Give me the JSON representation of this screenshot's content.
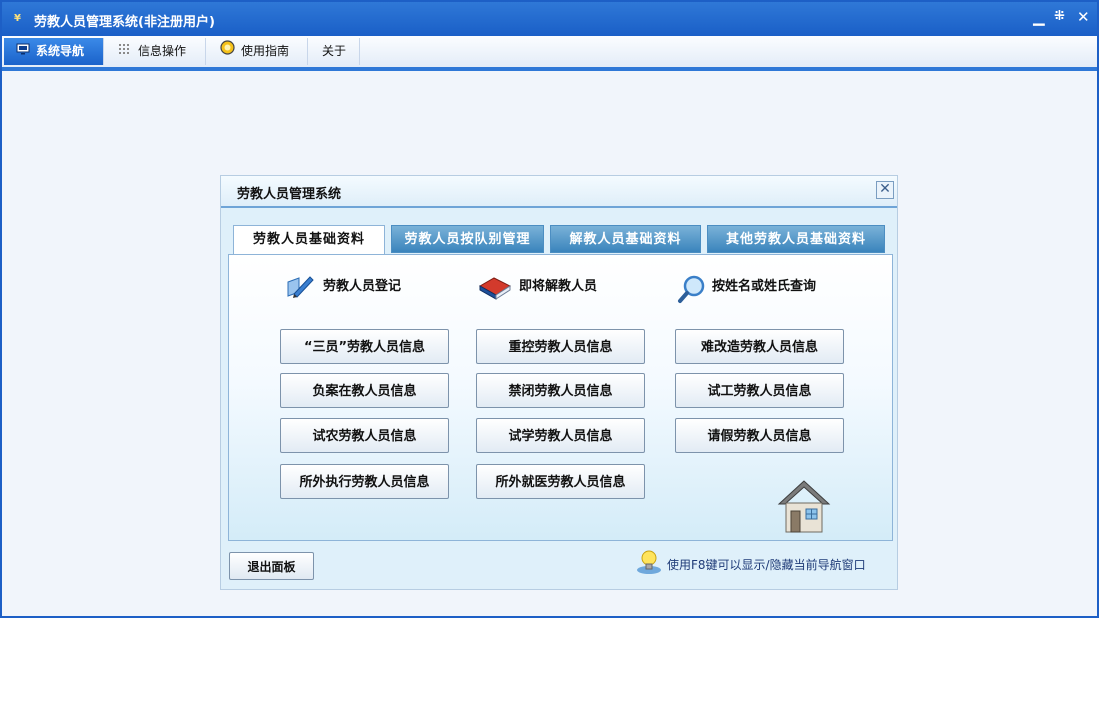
{
  "window": {
    "title": "劳教人员管理系统(非注册用户)",
    "app_icon": "¥"
  },
  "menu": {
    "tabs": [
      {
        "label": "系统导航",
        "icon": "monitor-icon"
      },
      {
        "label": "信息操作",
        "icon": "grid-icon"
      },
      {
        "label": "使用指南",
        "icon": "help-circle-icon"
      },
      {
        "label": "关于",
        "icon": ""
      }
    ]
  },
  "panel": {
    "title": "劳教人员管理系统",
    "close_glyph": "✕",
    "subtabs": [
      "劳教人员基础资料",
      "劳教人员按队别管理",
      "解教人员基础资料",
      "其他劳教人员基础资料"
    ],
    "quick_links": [
      {
        "label": "劳教人员登记",
        "icon": "edit-pen-icon"
      },
      {
        "label": "即将解教人员",
        "icon": "book-icon"
      },
      {
        "label": "按姓名或姓氏查询",
        "icon": "magnifier-icon"
      }
    ],
    "buttons": [
      "“三员”劳教人员信息",
      "重控劳教人员信息",
      "难改造劳教人员信息",
      "负案在教人员信息",
      "禁闭劳教人员信息",
      "试工劳教人员信息",
      "试农劳教人员信息",
      "试学劳教人员信息",
      "请假劳教人员信息",
      "所外执行劳教人员信息",
      "所外就医劳教人员信息"
    ],
    "exit_label": "退出面板",
    "hint": "使用F8键可以显示/隐藏当前导航窗口"
  },
  "colors": {
    "titlebar": "#1d5fc6",
    "active_tab": "#2f78d7",
    "panel_bg": "#dff0fa",
    "hint_text": "#1f3b78"
  }
}
